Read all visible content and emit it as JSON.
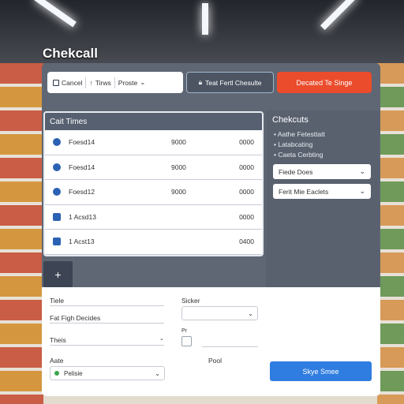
{
  "app": {
    "title": "Chekcall"
  },
  "toolbar": {
    "cancel_label": "Cancel",
    "items_label": "Tirws",
    "presets_label": "Proste",
    "checkout_label": "Teat Fertl Chesulte",
    "primary_label": "Decated Te Singe"
  },
  "cart": {
    "header": "Cait Times",
    "rows": [
      {
        "name": "Foesd14",
        "qty": "9000",
        "price": "0000"
      },
      {
        "name": "Foesd14",
        "qty": "9000",
        "price": "0000"
      },
      {
        "name": "Foesd12",
        "qty": "9000",
        "price": "0000"
      },
      {
        "name": "1 Acsd13",
        "qty": "",
        "price": "0000"
      },
      {
        "name": "1 Acst13",
        "qty": "",
        "price": "0400"
      }
    ],
    "add_label": "+"
  },
  "side": {
    "title": "Chekcuts",
    "bullets": [
      "Aathe Fetesttatt",
      "Latabcating",
      "Caeta Cerbting"
    ],
    "select1": "Fiede Does",
    "select2": "Ferit Mie Eaclets"
  },
  "form": {
    "label_tiele": "Tiele",
    "label_sicker": "Sicker",
    "label_fat": "Fat Figh Decides",
    "label_theis": "Theis",
    "label_pr": "Pr",
    "label_aate": "Aate",
    "label_pool": "Pool",
    "aate_value": "Pelisie",
    "pay_button": "Skye Smee"
  },
  "colors": {
    "accent_red": "#ea4c2c",
    "accent_blue": "#2f7de1",
    "panel": "#5f6775"
  }
}
